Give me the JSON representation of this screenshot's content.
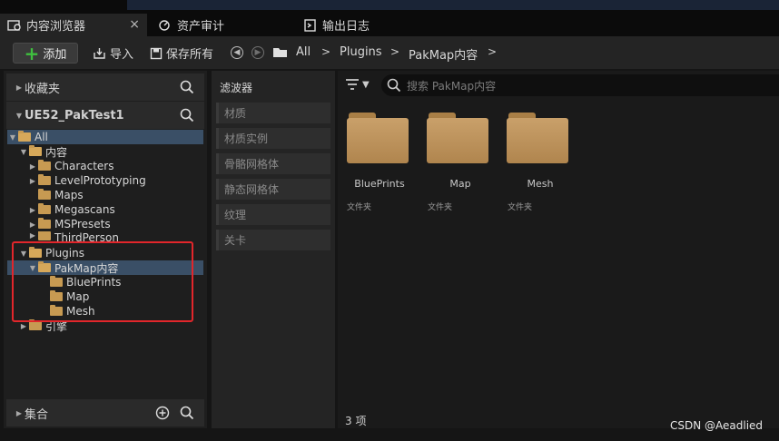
{
  "tabs": [
    {
      "label": "内容浏览器",
      "close": "×",
      "icon": "content-browser-icon"
    },
    {
      "label": "资产审计",
      "icon": "asset-audit-icon"
    },
    {
      "label": "输出日志",
      "icon": "output-log-icon"
    }
  ],
  "toolbar": {
    "add_label": "添加",
    "import_label": "导入",
    "save_all_label": "保存所有",
    "breadcrumbs": [
      "All",
      "Plugins",
      "PakMap内容"
    ],
    "separator": ">"
  },
  "left": {
    "favorites_label": "收藏夹",
    "project_label": "UE52_PakTest1",
    "collections_label": "集合",
    "tree": [
      {
        "label": "All"
      },
      {
        "label": "内容"
      },
      {
        "label": "Characters"
      },
      {
        "label": "LevelPrototyping"
      },
      {
        "label": "Maps"
      },
      {
        "label": "Megascans"
      },
      {
        "label": "MSPresets"
      },
      {
        "label": "ThirdPerson"
      },
      {
        "label": "Plugins"
      },
      {
        "label": "PakMap内容"
      },
      {
        "label": "BluePrints"
      },
      {
        "label": "Map"
      },
      {
        "label": "Mesh"
      },
      {
        "label": "引擎"
      }
    ]
  },
  "filters": {
    "title": "滤波器",
    "items": [
      "材质",
      "材质实例",
      "骨骼网格体",
      "静态网格体",
      "纹理",
      "关卡"
    ]
  },
  "main": {
    "search_placeholder": "搜索 PakMap内容",
    "assets": [
      {
        "name": "BluePrints",
        "type": "文件夹"
      },
      {
        "name": "Map",
        "type": "文件夹"
      },
      {
        "name": "Mesh",
        "type": "文件夹"
      }
    ],
    "count": "3 项"
  },
  "watermark": "CSDN @Aeadlied",
  "colors": {
    "highlight_box": "#e2262b",
    "selection": "#3a4f66",
    "folder": "#c79a52"
  }
}
